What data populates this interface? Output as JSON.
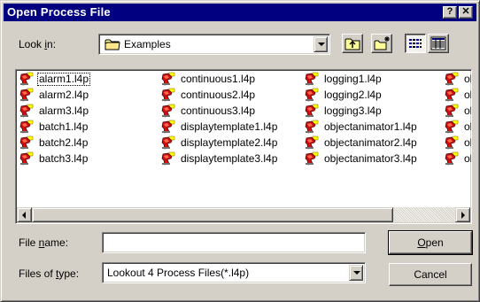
{
  "window": {
    "title": "Open Process File",
    "help_label": "?",
    "close_label": "✕"
  },
  "look_in": {
    "label_pre": "Look ",
    "label_key": "i",
    "label_post": "n:",
    "value": "Examples",
    "icon": "folder-icon"
  },
  "toolbar": {
    "up_folder_icon": "up-one-level-icon",
    "new_folder_icon": "new-folder-icon",
    "list_view_icon": "list-view-icon",
    "details_view_icon": "details-view-icon"
  },
  "files": [
    {
      "name": "alarm1.l4p",
      "focused": true
    },
    {
      "name": "alarm2.l4p"
    },
    {
      "name": "alarm3.l4p"
    },
    {
      "name": "batch1.l4p"
    },
    {
      "name": "batch2.l4p"
    },
    {
      "name": "batch3.l4p"
    },
    {
      "name": "continuous1.l4p"
    },
    {
      "name": "continuous2.l4p"
    },
    {
      "name": "continuous3.l4p"
    },
    {
      "name": "displaytemplate1.l4p"
    },
    {
      "name": "displaytemplate2.l4p"
    },
    {
      "name": "displaytemplate3.l4p"
    },
    {
      "name": "logging1.l4p"
    },
    {
      "name": "logging2.l4p"
    },
    {
      "name": "logging3.l4p"
    },
    {
      "name": "objectanimator1.l4p"
    },
    {
      "name": "objectanimator2.l4p"
    },
    {
      "name": "objectanimator3.l4p"
    },
    {
      "name": "ob"
    },
    {
      "name": "ob"
    },
    {
      "name": "ob"
    },
    {
      "name": "ob"
    },
    {
      "name": "ob"
    },
    {
      "name": "ob"
    }
  ],
  "file_name": {
    "label_pre": "File ",
    "label_key": "n",
    "label_post": "ame:",
    "value": ""
  },
  "file_type": {
    "label_pre": "Files of ",
    "label_key": "t",
    "label_post": "ype:",
    "value": "Lookout 4 Process Files(*.l4p)"
  },
  "buttons": {
    "open_key": "O",
    "open_rest": "pen",
    "cancel": "Cancel"
  },
  "colors": {
    "titlebar": "#000080",
    "face": "#d4d0c8"
  }
}
